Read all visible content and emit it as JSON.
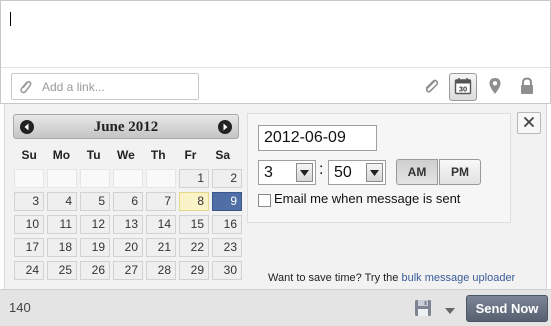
{
  "composer": {
    "message_text": "",
    "link_placeholder": "Add a link...",
    "icons": [
      "link-icon",
      "paperclip-icon",
      "calendar-icon",
      "location-pin-icon",
      "lock-icon"
    ],
    "calendar_icon_day": "30"
  },
  "calendar": {
    "title": "June 2012",
    "weekdays": [
      "Su",
      "Mo",
      "Tu",
      "We",
      "Th",
      "Fr",
      "Sa"
    ],
    "leading_blanks": 5,
    "days": [
      1,
      2,
      3,
      4,
      5,
      6,
      7,
      8,
      9,
      10,
      11,
      12,
      13,
      14,
      15,
      16,
      17,
      18,
      19,
      20,
      21,
      22,
      23,
      24,
      25,
      26,
      27,
      28,
      29,
      30
    ],
    "today": 8,
    "selected": 9,
    "colors": {
      "selected": "#4f6fa6",
      "today": "#fbf3c8"
    }
  },
  "schedule": {
    "date": "2012-06-09",
    "hour": "3",
    "minute": "50",
    "am_label": "AM",
    "pm_label": "PM",
    "meridiem_selected": "AM",
    "email_label": "Email me when message is sent",
    "email_checked": false
  },
  "bulk": {
    "prefix": "Want to save time? Try the",
    "link_label": "bulk message uploader"
  },
  "footer": {
    "char_count": "140",
    "send_label": "Send Now",
    "send_color": "#566071"
  }
}
